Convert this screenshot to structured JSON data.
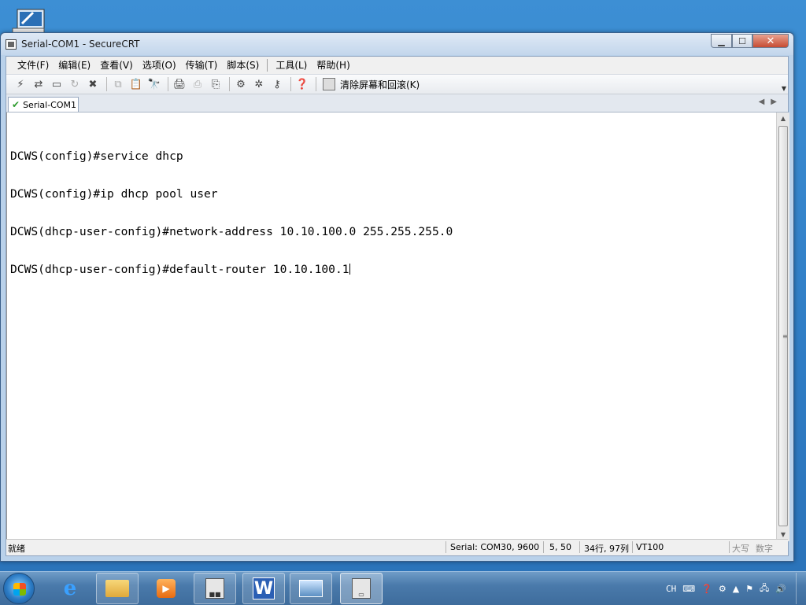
{
  "window": {
    "title": "Serial-COM1 - SecureCRT",
    "min_glyph": "▁",
    "max_glyph": "☐",
    "close_glyph": "✕"
  },
  "menu": [
    {
      "label": "文件(F)"
    },
    {
      "label": "编辑(E)"
    },
    {
      "label": "查看(V)"
    },
    {
      "label": "选项(O)"
    },
    {
      "label": "传输(T)"
    },
    {
      "label": "脚本(S)"
    },
    {
      "label": "工具(L)"
    },
    {
      "label": "帮助(H)"
    }
  ],
  "toolbar": {
    "clear_label": "清除屏幕和回滚(K)"
  },
  "tabs": [
    {
      "label": "Serial-COM1",
      "active": true
    }
  ],
  "terminal": {
    "lines": [
      "DCWS(config)#service dhcp",
      "DCWS(config)#ip dhcp pool user",
      "DCWS(dhcp-user-config)#network-address 10.10.100.0 255.255.255.0",
      "DCWS(dhcp-user-config)#default-router 10.10.100.1"
    ]
  },
  "statusbar": {
    "ready": "就绪",
    "connection": "Serial: COM30, 9600",
    "cursor": "5,  50",
    "size": "34行, 97列",
    "emulation": "VT100",
    "caps": "大写",
    "num": "数字"
  },
  "taskbar": {
    "apps": [
      {
        "name": "internet-explorer",
        "icon": "ie-icon"
      },
      {
        "name": "file-explorer",
        "icon": "folder-icon"
      },
      {
        "name": "media-player",
        "icon": "media-icon"
      },
      {
        "name": "securecrt",
        "icon": "crt-icon"
      },
      {
        "name": "word-app",
        "icon": "w-icon",
        "glyph": "W"
      },
      {
        "name": "picture-viewer",
        "icon": "picture-icon"
      },
      {
        "name": "securecrt-window",
        "icon": "terminal-icon"
      }
    ],
    "tray": {
      "lang": "CH",
      "time": ""
    }
  }
}
